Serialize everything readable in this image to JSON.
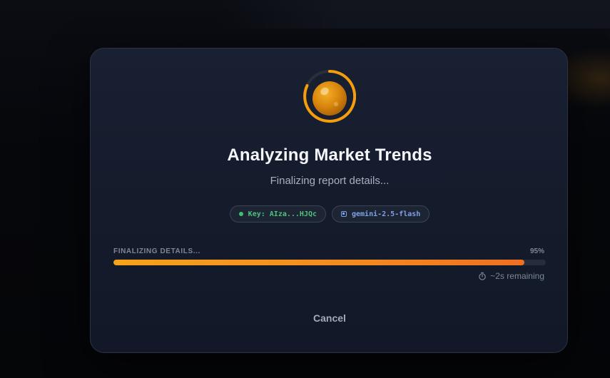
{
  "dialog": {
    "title": "Analyzing Market Trends",
    "subtitle": "Finalizing report details...",
    "badges": {
      "key_label": "Key: AIza...HJQc",
      "model_label": "gemini-2.5-flash"
    },
    "progress": {
      "stage_label": "FINALIZING DETAILS...",
      "percent_label": "95%",
      "fraction": 0.95,
      "remaining_label": "~2s remaining"
    },
    "cancel_label": "Cancel"
  },
  "colors": {
    "accent_orange": "#f59e0b",
    "key_status_green": "#3cc46c",
    "model_blue": "#7ea2e6",
    "modal_bg": "#161d2e",
    "page_bg": "#07090e"
  },
  "icons": {
    "spinner": "loading-orb-icon",
    "key_status": "status-dot-icon",
    "model": "chip-icon",
    "timer": "stopwatch-icon"
  }
}
